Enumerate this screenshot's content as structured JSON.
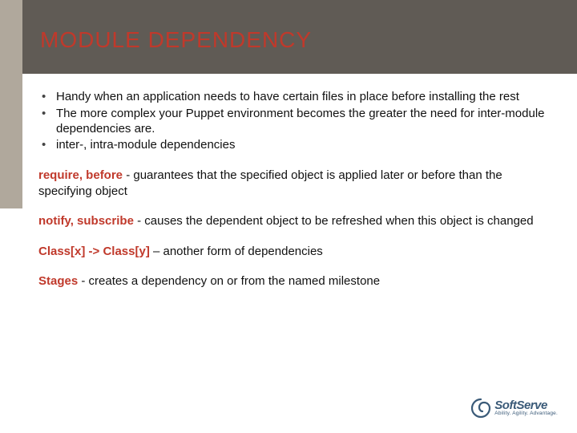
{
  "title": "MODULE DEPENDENCY",
  "bullets": [
    "Handy when an application needs to have certain files in place before installing the rest",
    "The more complex your Puppet environment becomes the greater the need for inter-module dependencies are.",
    "inter-, intra-module dependencies"
  ],
  "defs": [
    {
      "kw": "require, before",
      "sep": "  - ",
      "text": "guarantees that the specified object is applied later or before than the specifying object"
    },
    {
      "kw": "notify, subscribe",
      "sep": " - ",
      "text": "causes the dependent object to be refreshed when this object is changed"
    },
    {
      "kw": "Class[x] -> Class[y]",
      "sep": " – ",
      "text": "another form of dependencies"
    },
    {
      "kw": "Stages",
      "sep": " - ",
      "text": "creates a dependency on or from the named milestone"
    }
  ],
  "logo": {
    "name": "SoftServe",
    "tagline": "Ability. Agility. Advantage."
  }
}
